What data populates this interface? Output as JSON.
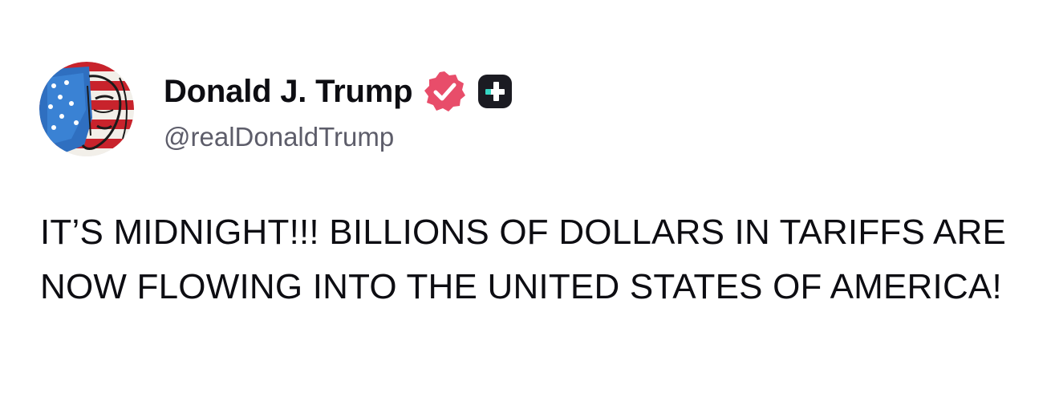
{
  "author": {
    "display_name": "Donald J. Trump",
    "handle": "@realDonaldTrump",
    "avatar_icon": "flag-portrait-avatar",
    "verified_icon": "verified-badge-icon",
    "verified_color": "#e84d6a",
    "plus_badge_icon": "plus-badge-icon",
    "plus_badge_color": "#1b1b22",
    "plus_badge_accent": "#36d7c4"
  },
  "post": {
    "text": "IT’S MIDNIGHT!!! BILLIONS OF DOLLARS IN TARIFFS ARE NOW FLOWING INTO THE UNITED STATES OF AMERICA!"
  }
}
